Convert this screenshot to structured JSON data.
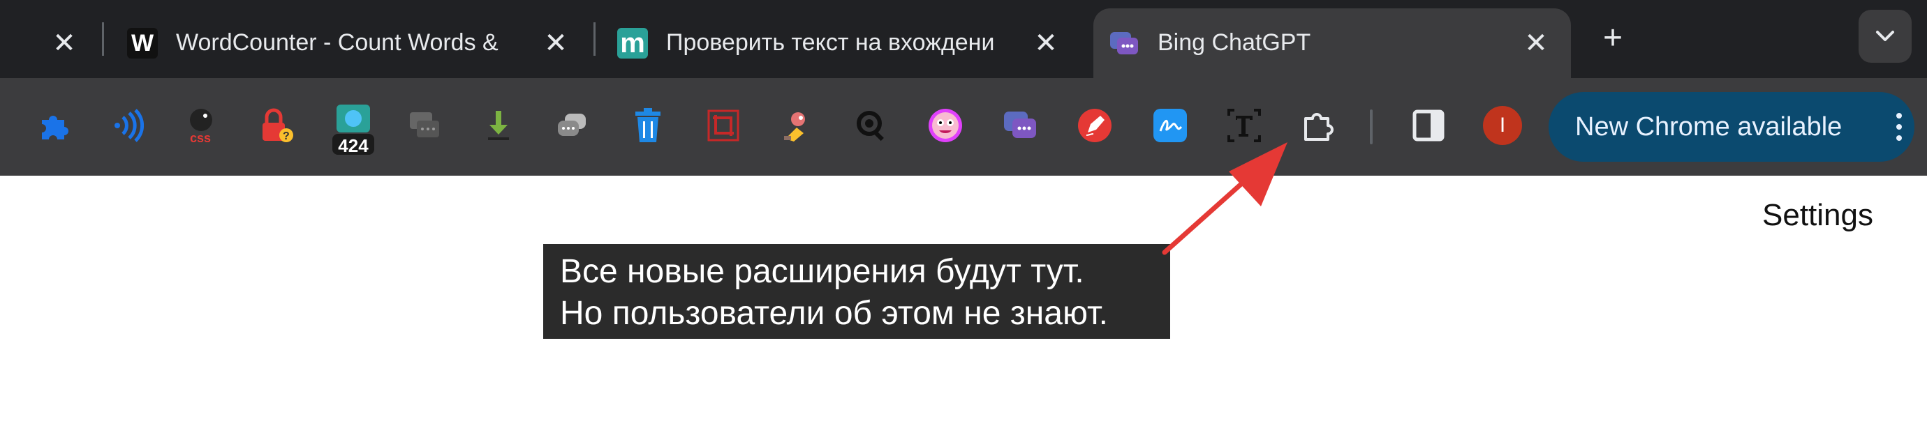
{
  "tabs": [
    {
      "title": "",
      "has_close": true
    },
    {
      "title": "WordCounter - Count Words &",
      "favicon_text": "W",
      "has_close": true
    },
    {
      "title": "Проверить текст на вхождени",
      "favicon_text": "m",
      "has_close": true
    },
    {
      "title": "Bing ChatGPT",
      "active": true,
      "has_close": true
    }
  ],
  "tabstrip": {
    "new_tab_icon": "plus-icon",
    "tab_search_icon": "chevron-down-icon"
  },
  "toolbar": {
    "extensions": [
      {
        "name": "puzzle-icon",
        "color": "#1a73e8"
      },
      {
        "name": "wifi-sound-icon",
        "color": "#1a73e8"
      },
      {
        "name": "css-icon",
        "badge_text": "css",
        "color": "#e53935"
      },
      {
        "name": "lock-icon",
        "color": "#e53935"
      },
      {
        "name": "counter-icon",
        "badge_text": "424",
        "color": "#2aa198"
      },
      {
        "name": "chat-gray-icon",
        "color": "#777"
      },
      {
        "name": "download-icon",
        "color": "#7cb342"
      },
      {
        "name": "chat-bubbles-icon",
        "color": "#9e9e9e"
      },
      {
        "name": "trash-icon",
        "color": "#1e88e5"
      },
      {
        "name": "crop-icon",
        "color": "#c62828"
      },
      {
        "name": "sprite-icon",
        "color": "#e57373"
      },
      {
        "name": "search-gear-icon",
        "color": "#111"
      },
      {
        "name": "smiley-icon",
        "color": "#e040fb"
      },
      {
        "name": "bing-chat-icon",
        "color": "#5c6bc0"
      },
      {
        "name": "pen-icon",
        "color": "#e53935"
      },
      {
        "name": "signature-icon",
        "color": "#2196f3"
      },
      {
        "name": "text-t-icon",
        "color": "#111"
      },
      {
        "name": "extensions-puzzle-icon",
        "color": "#e8eaed"
      }
    ],
    "side_panel_icon": "side-panel-icon",
    "profile": {
      "initial": "I",
      "color": "#c0341d"
    },
    "update_button": {
      "label": "New Chrome available"
    }
  },
  "settings_label": "Settings",
  "tooltip": {
    "line1": "Все новые расширения будут тут.",
    "line2": "Но пользователи об этом не знают."
  },
  "colors": {
    "tabstrip": "#202124",
    "toolbar": "#3c3c3e",
    "update_button": "#0b4a6f",
    "arrow": "#e53935"
  }
}
